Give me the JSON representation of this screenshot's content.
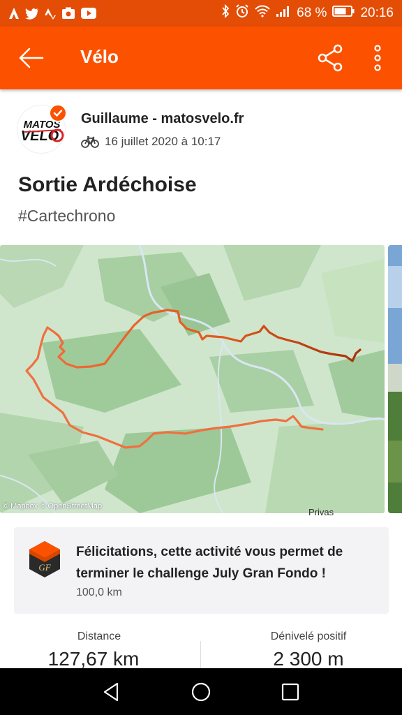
{
  "status_bar": {
    "notification_icons": [
      "strava-icon",
      "twitter-icon",
      "strava-icon",
      "photo-icon",
      "youtube-icon"
    ],
    "battery_percent": "68 %",
    "time": "20:16"
  },
  "app_bar": {
    "title": "Vélo"
  },
  "athlete": {
    "name": "Guillaume - matosvelo.fr",
    "date": "16 juillet 2020 à 10:17",
    "avatar_text": "MATOS VELO"
  },
  "activity": {
    "title": "Sortie Ardéchoise",
    "description": "#Cartechrono"
  },
  "map": {
    "attribution": "© Mapbox © OpenStreetMap",
    "place_label": "Privas"
  },
  "achievement": {
    "text": "Félicitations, cette activité vous permet de terminer le challenge July Gran Fondo !",
    "subtext": "100,0 km"
  },
  "stats": {
    "distance_label": "Distance",
    "distance_value": "127,67 km",
    "elevation_label": "Dénivelé positif",
    "elevation_value": "2 300 m"
  },
  "colors": {
    "brand": "#fc5200",
    "status_bar": "#e44d06",
    "route_start": "#f26b3a",
    "route_end": "#a8320c"
  }
}
